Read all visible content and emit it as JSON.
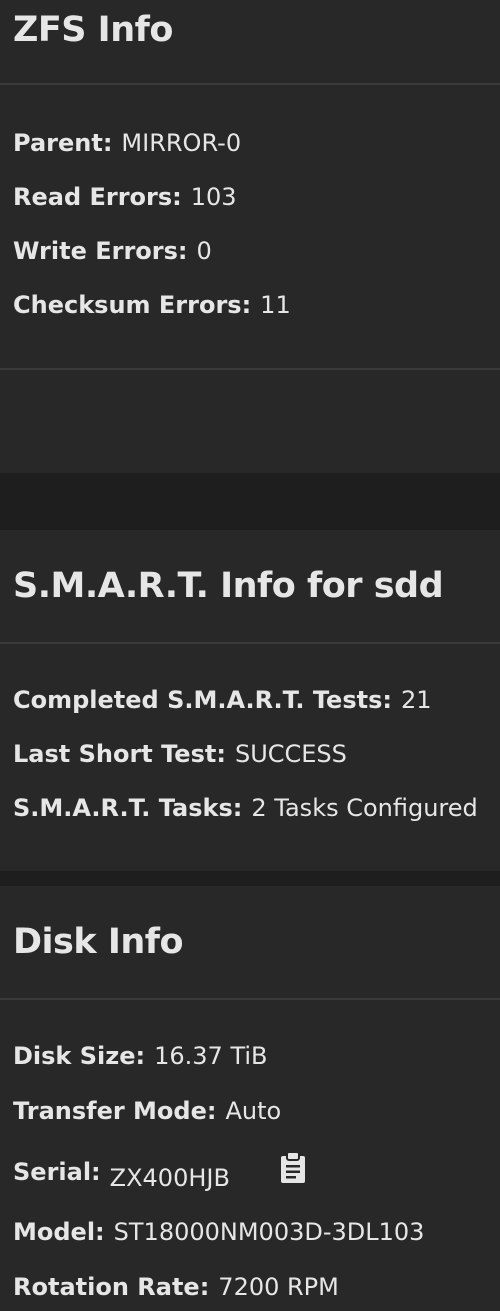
{
  "zfs": {
    "title": "ZFS Info",
    "parent_label": "Parent:",
    "parent_value": "MIRROR-0",
    "read_label": "Read Errors:",
    "read_value": "103",
    "write_label": "Write Errors:",
    "write_value": "0",
    "checksum_label": "Checksum Errors:",
    "checksum_value": "11"
  },
  "smart": {
    "title": "S.M.A.R.T. Info for sdd",
    "completed_label": "Completed S.M.A.R.T. Tests:",
    "completed_value": "21",
    "last_short_label": "Last Short Test:",
    "last_short_value": "SUCCESS",
    "tasks_label": "S.M.A.R.T. Tasks:",
    "tasks_value": "2 Tasks Configured"
  },
  "disk": {
    "title": "Disk Info",
    "size_label": "Disk Size:",
    "size_value": "16.37 TiB",
    "transfer_label": "Transfer Mode:",
    "transfer_value": "Auto",
    "serial_label": "Serial:",
    "serial_value": "ZX400HJB",
    "model_label": "Model:",
    "model_value": "ST18000NM003D-3DL103",
    "rotation_label": "Rotation Rate:",
    "rotation_value": "7200 RPM"
  },
  "icons": {
    "copy_serial": "clipboard-icon"
  },
  "colors": {
    "background": "#1e1e1e",
    "card": "#282828",
    "divider": "#3a3a3a",
    "text": "#e6e6e6"
  }
}
